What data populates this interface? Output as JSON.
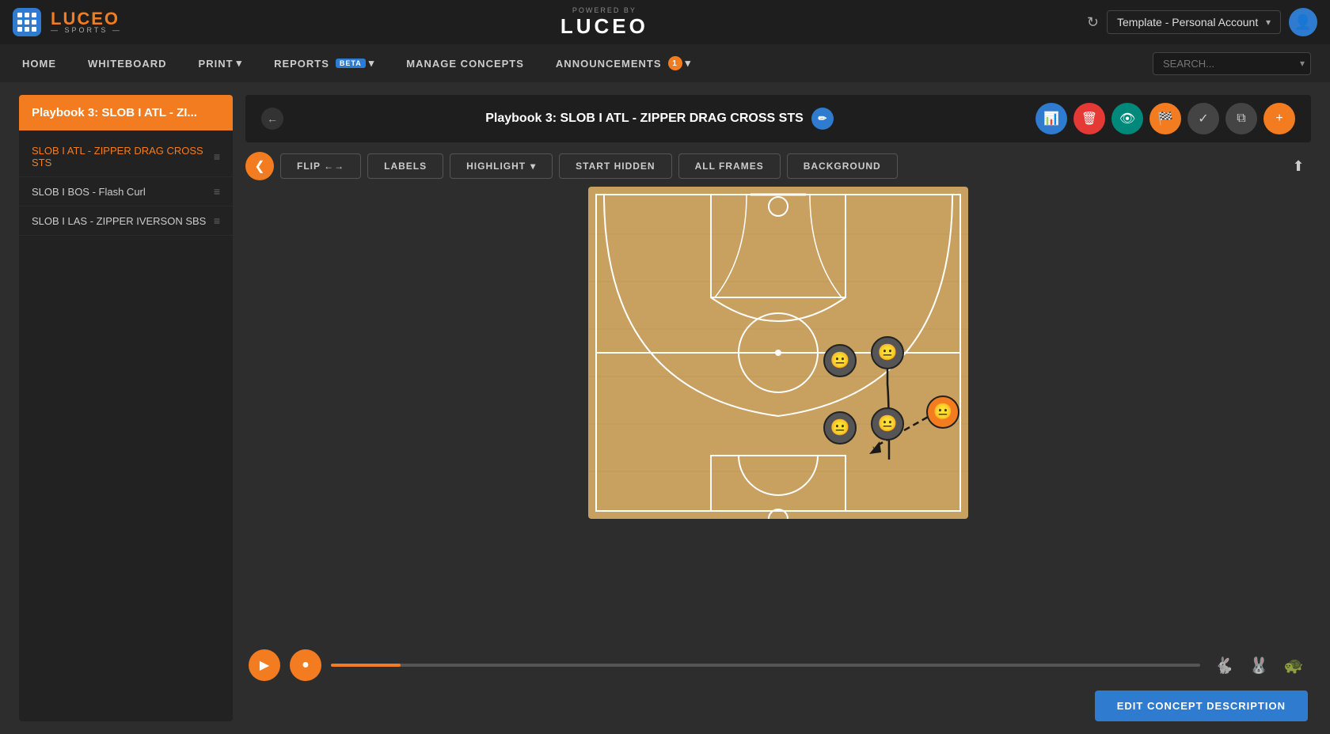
{
  "topbar": {
    "account_label": "Template - Personal Account",
    "refresh_icon": "↻",
    "chevron": "▾",
    "avatar_icon": "👤"
  },
  "powered_by": "POWERED BY",
  "luceo_center": "LUCEO",
  "nav": {
    "items": [
      {
        "id": "home",
        "label": "HOME"
      },
      {
        "id": "whiteboard",
        "label": "WHITEBOARD"
      },
      {
        "id": "print",
        "label": "PRINT",
        "arrow": true
      },
      {
        "id": "reports",
        "label": "REPORTS",
        "arrow": true,
        "badge": "BETA"
      },
      {
        "id": "manage-concepts",
        "label": "MANAGE CONCEPTS"
      },
      {
        "id": "announcements",
        "label": "ANNOUNCEMENTS",
        "arrow": true,
        "notif": "1"
      }
    ],
    "search_placeholder": "SEARCH..."
  },
  "playbook": {
    "title": "Playbook 3: SLOB I ATL - ZIPPER DRAG CROSS STS",
    "title_short": "Playbook 3: SLOB I ATL - ZI...",
    "back_icon": "←",
    "edit_icon": "✏",
    "actions": [
      {
        "id": "chart",
        "icon": "📊",
        "class": "blue"
      },
      {
        "id": "delete",
        "icon": "🗑",
        "class": "red"
      },
      {
        "id": "view",
        "icon": "👁",
        "class": "teal"
      },
      {
        "id": "flag",
        "icon": "🏳",
        "class": "orange"
      },
      {
        "id": "check",
        "icon": "✓",
        "class": "dark"
      },
      {
        "id": "copy",
        "icon": "⧉",
        "class": "dark"
      },
      {
        "id": "add",
        "icon": "+",
        "class": "orange"
      }
    ]
  },
  "concepts": [
    {
      "id": 1,
      "label": "SLOB I ATL - ZIPPER DRAG CROSS STS",
      "active": true
    },
    {
      "id": 2,
      "label": "SLOB I BOS - Flash Curl",
      "active": false
    },
    {
      "id": 3,
      "label": "SLOB I LAS - ZIPPER IVERSON SBS",
      "active": false
    }
  ],
  "toolbar": {
    "prev_icon": "❮",
    "flip_label": "FLIP ←→",
    "labels_label": "LABELS",
    "highlight_label": "HIGHLIGHT",
    "highlight_arrow": "▾",
    "start_hidden_label": "START HIDDEN",
    "all_frames_label": "ALL FRAMES",
    "background_label": "BACKGROUND",
    "upload_icon": "⬆"
  },
  "playback": {
    "play_icon": "▶",
    "step_icon": "●",
    "speed_icons": [
      "🐇",
      "🐰",
      "🐢"
    ]
  },
  "edit_concept": {
    "label": "EDIT CONCEPT DESCRIPTION"
  }
}
